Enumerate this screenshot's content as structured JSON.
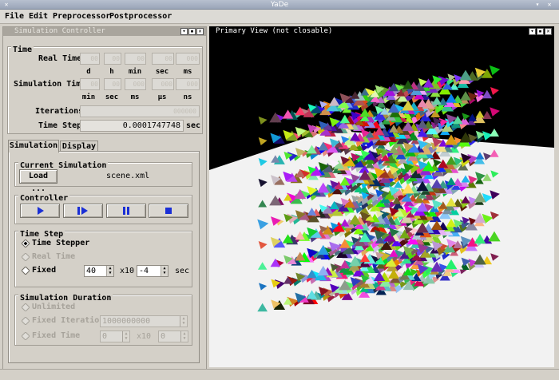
{
  "window": {
    "title": "YaDe"
  },
  "menu": {
    "file": "File",
    "edit": "Edit",
    "preprocessor": "Preprocessor",
    "postprocessor": "Postprocessor"
  },
  "controller": {
    "dock_title": "Simulation Controller",
    "time_group": "Time",
    "real_time_label": "Real Time",
    "real_time_units": [
      "d",
      "h",
      "min",
      "sec",
      "ms"
    ],
    "sim_time_label": "Simulation Time",
    "sim_time_units": [
      "min",
      "sec",
      "ms",
      "µs",
      "ns"
    ],
    "iterations_label": "Iterations",
    "time_step_label": "Time Step",
    "time_step_value": "0.0001747748",
    "time_step_unit": "sec"
  },
  "tabs": {
    "simulation": "Simulation",
    "display": "Display"
  },
  "simulation_tab": {
    "current_sim_group": "Current Simulation",
    "load_button": "Load ...",
    "scene_file": "scene.xml",
    "controller_group": "Controller",
    "time_step_group": "Time Step",
    "time_stepper": "Time Stepper",
    "real_time": "Real Time",
    "fixed": "Fixed",
    "fixed_value": "40",
    "times_ten": "x10",
    "fixed_exponent": "-4",
    "sec": "sec",
    "duration_group": "Simulation Duration",
    "unlimited": "Unlimited",
    "fixed_iterations": "Fixed Iterations",
    "fixed_iterations_value": "1000000000",
    "fixed_time": "Fixed Time",
    "fixed_time_value": "0",
    "fixed_time_exponent": "0"
  },
  "viewport": {
    "title": "Primary View (not closable)",
    "background_color": "#000000",
    "floor_color": "#f2f2f2"
  }
}
